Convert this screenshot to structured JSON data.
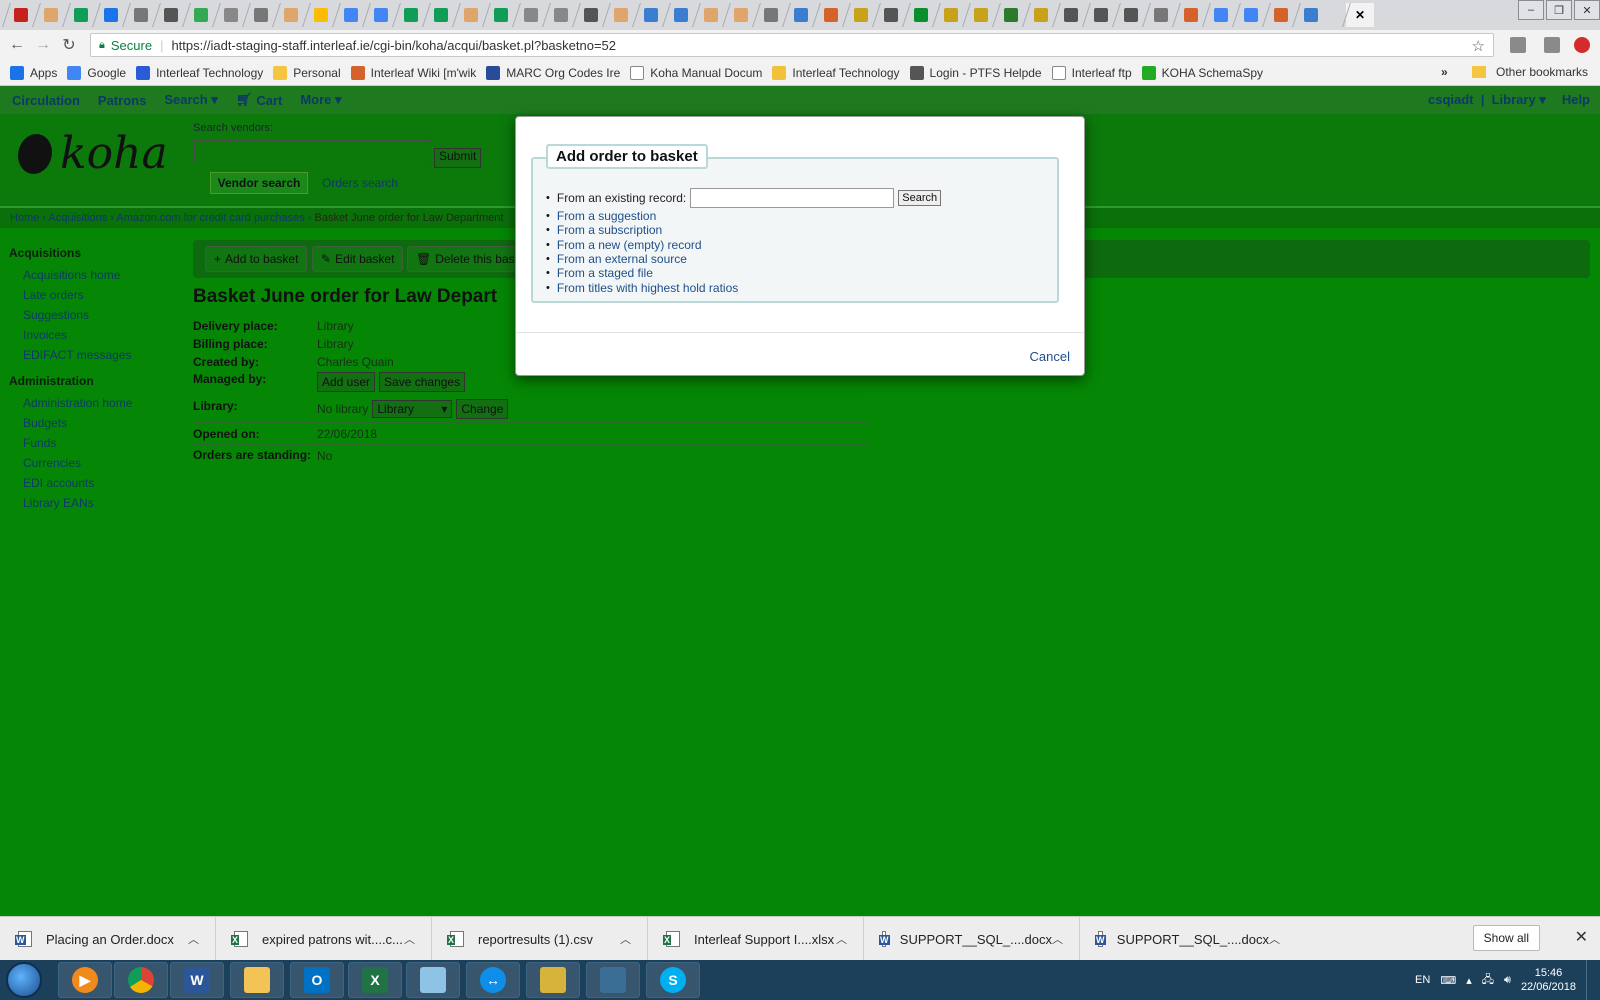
{
  "browser": {
    "url": "https://iadt-staging-staff.interleaf.ie/cgi-bin/koha/acqui/basket.pl?basketno=52",
    "secure_label": "Secure",
    "bookmarks": [
      "Apps",
      "Google",
      "Interleaf Technology",
      "Personal",
      "Interleaf Wiki [m'wik",
      "MARC Org Codes Ire",
      "Koha Manual Docum",
      "Interleaf Technology",
      "Login - PTFS Helpde",
      "Interleaf ftp",
      "KOHA SchemaSpy"
    ],
    "bookmarks_overflow": "»",
    "other_bookmarks": "Other bookmarks"
  },
  "koha": {
    "nav": [
      "Circulation",
      "Patrons",
      "Search ▾",
      "Cart",
      "More ▾"
    ],
    "user": "csqiadt",
    "branch": "Library ▾",
    "help": "Help",
    "logo_text": "koha",
    "search_vendors_label": "Search vendors:",
    "submit_label": "Submit",
    "vendor_search_tab": "Vendor search",
    "orders_search_tab": "Orders search",
    "breadcrumb": {
      "home": "Home",
      "acquisitions": "Acquisitions",
      "vendor": "Amazon.com for credit card purchases",
      "current": "Basket June order for Law Department"
    },
    "sidebar": {
      "acq_heading": "Acquisitions",
      "acq_links": [
        "Acquisitions home",
        "Late orders",
        "Suggestions",
        "Invoices",
        "EDIFACT messages"
      ],
      "admin_heading": "Administration",
      "admin_links": [
        "Administration home",
        "Budgets",
        "Funds",
        "Currencies",
        "EDI accounts",
        "Library EANs"
      ]
    },
    "toolbar": {
      "add": "Add to basket",
      "edit": "Edit basket",
      "delete": "Delete this baske"
    },
    "basket_title": "Basket June order for Law Depart",
    "details": {
      "delivery_k": "Delivery place:",
      "delivery_v": "Library",
      "billing_k": "Billing place:",
      "billing_v": "Library",
      "created_k": "Created by:",
      "created_v": "Charles Quain",
      "managed_k": "Managed by:",
      "add_user": "Add user",
      "save_changes": "Save changes",
      "library_k": "Library:",
      "library_v": "No library",
      "library_select": "Library",
      "change": "Change",
      "opened_k": "Opened on:",
      "opened_v": "22/06/2018",
      "standing_k": "Orders are standing:",
      "standing_v": "No"
    }
  },
  "modal": {
    "title": "Add order to basket",
    "existing_label": "From an existing record:",
    "search_label": "Search",
    "options": [
      "From a suggestion",
      "From a subscription",
      "From a new (empty) record",
      "From an external source",
      "From a staged file",
      "From titles with highest hold ratios"
    ],
    "cancel": "Cancel"
  },
  "downloads": {
    "items": [
      {
        "name": "Placing an Order.docx",
        "kind": "word"
      },
      {
        "name": "expired patrons wit....c...",
        "kind": "excel"
      },
      {
        "name": "reportresults (1).csv",
        "kind": "excel"
      },
      {
        "name": "Interleaf Support I....xlsx",
        "kind": "excel"
      },
      {
        "name": "SUPPORT__SQL_....docx",
        "kind": "word"
      },
      {
        "name": "SUPPORT__SQL_....docx",
        "kind": "word"
      }
    ],
    "show_all": "Show all"
  },
  "taskbar": {
    "lang": "EN",
    "time": "15:46",
    "date": "22/06/2018"
  },
  "colors": {
    "page_bg": "#058705",
    "link": "#1f4f8a"
  }
}
